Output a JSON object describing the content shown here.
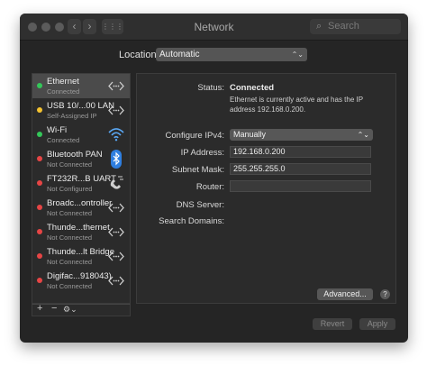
{
  "window": {
    "title": "Network",
    "search_placeholder": "Search"
  },
  "nav": {
    "back": "‹",
    "forward": "›",
    "grid": "⋮⋮⋮"
  },
  "location": {
    "label": "Location:",
    "value": "Automatic"
  },
  "services": [
    {
      "name": "Ethernet",
      "status": "Connected",
      "dot": "#34c759",
      "icon": "ethernet-icon"
    },
    {
      "name": "USB 10/...00 LAN",
      "status": "Self-Assigned IP",
      "dot": "#f5c330",
      "icon": "ethernet-icon"
    },
    {
      "name": "Wi-Fi",
      "status": "Connected",
      "dot": "#34c759",
      "icon": "wifi-icon"
    },
    {
      "name": "Bluetooth PAN",
      "status": "Not Connected",
      "dot": "#e64545",
      "icon": "bluetooth-icon"
    },
    {
      "name": "FT232R...B UART",
      "status": "Not Configured",
      "dot": "#e64545",
      "icon": "phone-icon"
    },
    {
      "name": "Broadc...ontroller",
      "status": "Not Connected",
      "dot": "#e64545",
      "icon": "ethernet-icon"
    },
    {
      "name": "Thunde...thernet",
      "status": "Not Connected",
      "dot": "#e64545",
      "icon": "ethernet-icon"
    },
    {
      "name": "Thunde...lt Bridge",
      "status": "Not Connected",
      "dot": "#e64545",
      "icon": "ethernet-icon"
    },
    {
      "name": "Digifac...918043)",
      "status": "Not Connected",
      "dot": "#e64545",
      "icon": "ethernet-icon"
    }
  ],
  "sidebar_toolbar": {
    "add": "+",
    "remove": "−",
    "action": "⚙⌄"
  },
  "detail": {
    "status_label": "Status:",
    "status_value": "Connected",
    "status_desc": "Ethernet is currently active and has the IP address 192.168.0.200.",
    "configure_label": "Configure IPv4:",
    "configure_value": "Manually",
    "ip_label": "IP Address:",
    "ip_value": "192.168.0.200",
    "mask_label": "Subnet Mask:",
    "mask_value": "255.255.255.0",
    "router_label": "Router:",
    "router_value": "",
    "dns_label": "DNS Server:",
    "search_label": "Search Domains:",
    "advanced_button": "Advanced...",
    "help": "?"
  },
  "footer": {
    "revert": "Revert",
    "apply": "Apply"
  }
}
